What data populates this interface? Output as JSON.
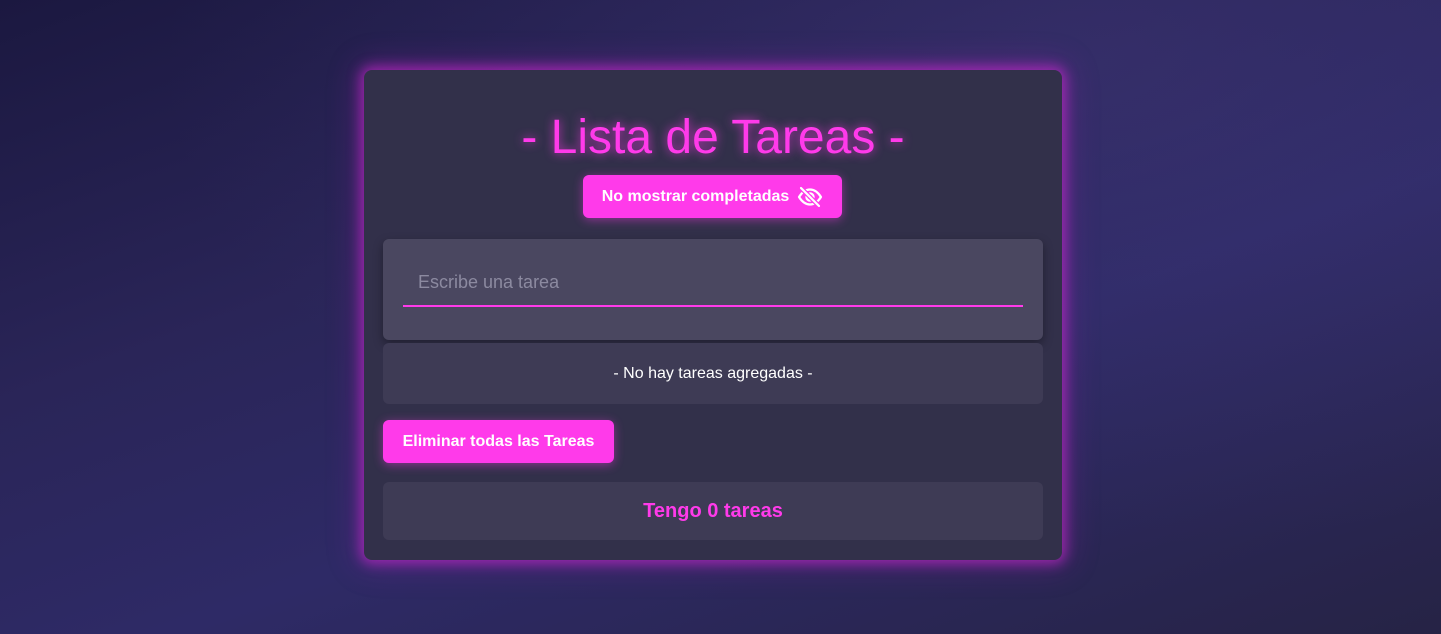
{
  "app": {
    "title": "- Lista de Tareas -"
  },
  "toolbar": {
    "toggle_completed_label": "No mostrar completadas",
    "toggle_completed_icon": "eye-slash-icon",
    "delete_all_label": "Eliminar todas las Tareas"
  },
  "form": {
    "input_value": "",
    "input_placeholder": "Escribe una tarea"
  },
  "tasks": {
    "items": [],
    "empty_message": "- No hay tareas agregadas -"
  },
  "footer": {
    "count_text": "Tengo 0 tareas"
  },
  "colors": {
    "accent": "#ff3aea",
    "card": "#32304a",
    "panel": "#3e3b55",
    "input_panel": "#4a4760"
  }
}
